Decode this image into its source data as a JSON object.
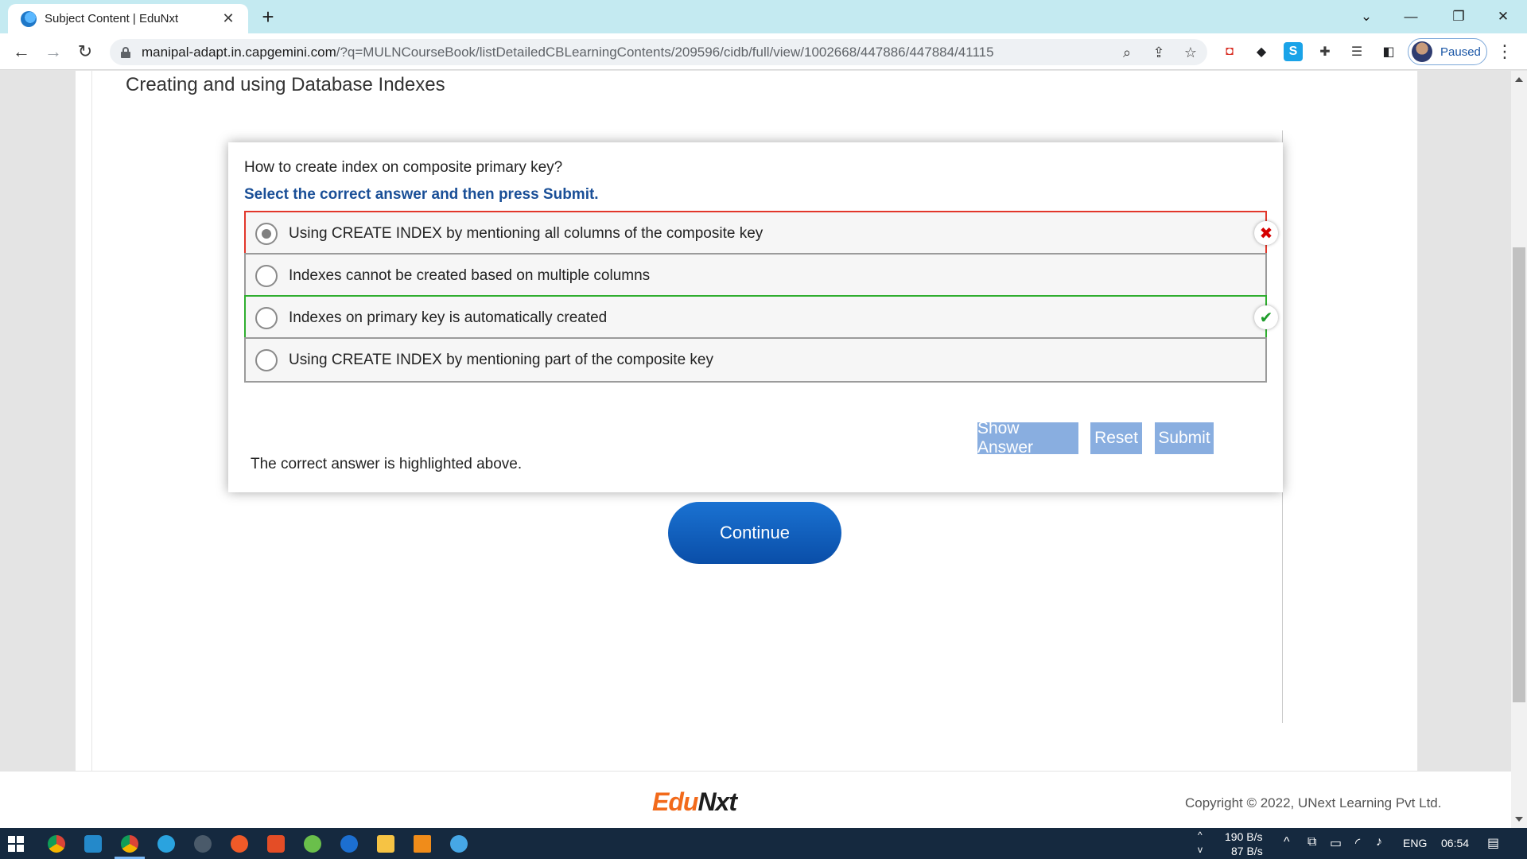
{
  "browser": {
    "tab_title": "Subject Content | EduNxt",
    "tab_close": "✕",
    "new_tab": "+",
    "url_host": "manipal-adapt.in.capgemini.com",
    "url_path": "/?q=MULNCourseBook/listDetailedCBLearningContents/209596/cidb/full/view/1002668/447886/447884/41115",
    "profile_label": "Paused"
  },
  "page": {
    "heading": "Creating and using Database Indexes"
  },
  "quiz": {
    "question": "How to create index on composite primary key?",
    "instruction": "Select the correct answer and then press Submit.",
    "options": [
      {
        "label": "Using CREATE INDEX by mentioning all columns of the composite key",
        "selected": true,
        "status": "wrong"
      },
      {
        "label": "Indexes cannot be created based on multiple columns",
        "selected": false,
        "status": "none"
      },
      {
        "label": "Indexes on primary key is automatically created",
        "selected": false,
        "status": "correct"
      },
      {
        "label": "Using CREATE INDEX by mentioning part of the composite key",
        "selected": false,
        "status": "none"
      }
    ],
    "wrong_mark": "✖",
    "correct_mark": "✔",
    "buttons": {
      "show_answer": "Show Answer",
      "reset": "Reset",
      "submit": "Submit"
    },
    "feedback": "The correct answer is highlighted above."
  },
  "continue_label": "Continue",
  "footer": {
    "logo_edu": "Edu",
    "logo_nxt": "Nxt",
    "copyright": "Copyright © 2022, UNext Learning Pvt Ltd."
  },
  "taskbar": {
    "net_up": "190 B/s",
    "net_down": "87 B/s",
    "language": "ENG",
    "time": "06:54"
  },
  "colors": {
    "tabstrip": "#c4eaf1",
    "wrong_border": "#e2372b",
    "correct_border": "#2fae2f",
    "instruction_text": "#1a4f97",
    "quiz_button": "#89aee0",
    "continue_button": "#0a4ea8",
    "logo_orange": "#f26a1b",
    "taskbar": "#15293f"
  }
}
